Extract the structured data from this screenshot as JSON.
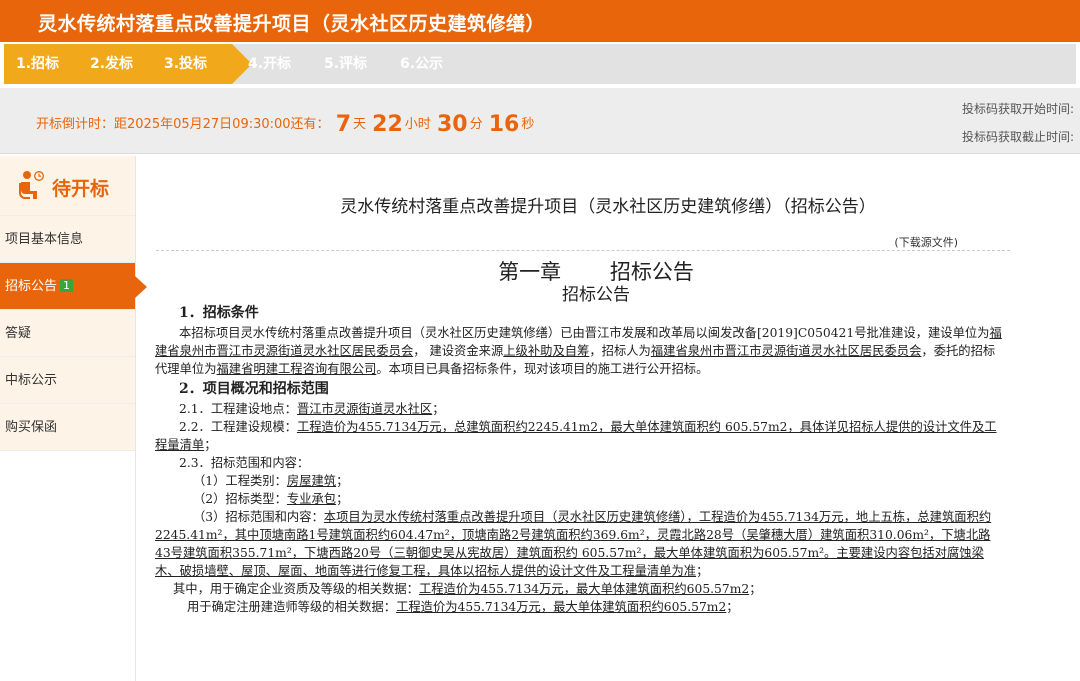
{
  "header": {
    "title": "灵水传统村落重点改善提升项目（灵水社区历史建筑修缮）"
  },
  "steps": [
    {
      "label": "1.招标",
      "state": "done"
    },
    {
      "label": "2.发标",
      "state": "done"
    },
    {
      "label": "3.投标",
      "state": "current"
    },
    {
      "label": "4.开标",
      "state": "todo"
    },
    {
      "label": "5.评标",
      "state": "todo"
    },
    {
      "label": "6.公示",
      "state": "todo"
    }
  ],
  "countdown": {
    "prefix": "开标倒计时：距2025年05月27日09:30:00还有：",
    "days": "7",
    "days_unit": "天",
    "hours": "22",
    "hours_unit": "小时",
    "minutes": "30",
    "minutes_unit": "分",
    "seconds": "16",
    "seconds_unit": "秒",
    "code_start_label": "投标码获取开始时间:",
    "code_end_label": "投标码获取截止时间:"
  },
  "sidebar": {
    "heading": "待开标",
    "items": [
      {
        "label": "项目基本信息"
      },
      {
        "label": "招标公告",
        "badge": "1"
      },
      {
        "label": "答疑"
      },
      {
        "label": "中标公示"
      },
      {
        "label": "购买保函"
      }
    ]
  },
  "main": {
    "title": "灵水传统村落重点改善提升项目（灵水社区历史建筑修缮）（招标公告）",
    "download": "(下载源文件)",
    "chapter": "第一章　　 招标公告",
    "chapter_sub": "招标公告",
    "sec1": "1．招标条件",
    "p1a": "本招标项目灵水传统村落重点改善提升项目（灵水社区历史建筑修缮）已由晋江市发展和改革局以闽发改备[2019]C050421号批准建设，建设单位为",
    "p1b": "福建省泉州市晋江市灵源街道灵水社区居民委员会",
    "p1c": "，  建设资金来源",
    "p1d": "上级补助及自筹",
    "p1e": "，招标人为",
    "p1f": "福建省泉州市晋江市灵源街道灵水社区居民委员会",
    "p1g": "，委托的招标代理单位为",
    "p1h": "福建省明建工程咨询有限公司",
    "p1i": "。本项目已具备招标条件，现对该项目的施工进行公开招标。",
    "sec2": "2．项目概况和招标范围",
    "l21a": "2.1．工程建设地点：",
    "l21b": "晋江市灵源街道灵水社区",
    "l21c": "；",
    "l22a": "2.2．工程建设规模：",
    "l22b": "工程造价为455.7134万元，总建筑面积约2245.41m2，最大单体建筑面积约 605.57m2，具体详见招标人提供的设计文件及工程量清单",
    "l22c": "；",
    "l23": "2.3．招标范围和内容：",
    "l231a": "（1）工程类别：",
    "l231b": "房屋建筑",
    "l231c": "；",
    "l232a": "（2）招标类型：",
    "l232b": "专业承包",
    "l232c": "；",
    "l233a": "（3）招标范围和内容：",
    "l233b": "本项目为灵水传统村落重点改善提升项目（灵水社区历史建筑修缮），工程造价为455.7134万元，地上五栋，总建筑面积约2245.41m²，其中顶塘南路1号建筑面积约604.47m²，顶塘南路2号建筑面积约369.6m²，灵霞北路28号（吴肇穗大厝）建筑面积310.06m²，下塘北路43号建筑面积355.71m²，下塘西路20号（三朝御史吴从宪故居）建筑面积约 605.57m²，最大单体建筑面积为605.57m²。主要建设内容包括对腐蚀梁木、破损墙壁、屋顶、屋面、地面等进行修复工程，具体以招标人提供的设计文件及工程量清单为准",
    "l233c": "；",
    "l24a": "其中，用于确定企业资质及等级的相关数据：",
    "l24b": "工程造价为455.7134万元，最大单体建筑面积约605.57m2",
    "l24c": "；",
    "l25a": "用于确定注册建造师等级的相关数据：",
    "l25b": "工程造价为455.7134万元，最大单体建筑面积约605.57m2",
    "l25c": "；"
  },
  "colors": {
    "brand": "#e8650b",
    "step_done": "#f2a81b",
    "step_todo": "#e2e2e2",
    "badge": "#3aa53a"
  },
  "icons": {
    "sidebar_heading": "person-clock-icon",
    "active_pointer": "arrow-right-icon"
  }
}
